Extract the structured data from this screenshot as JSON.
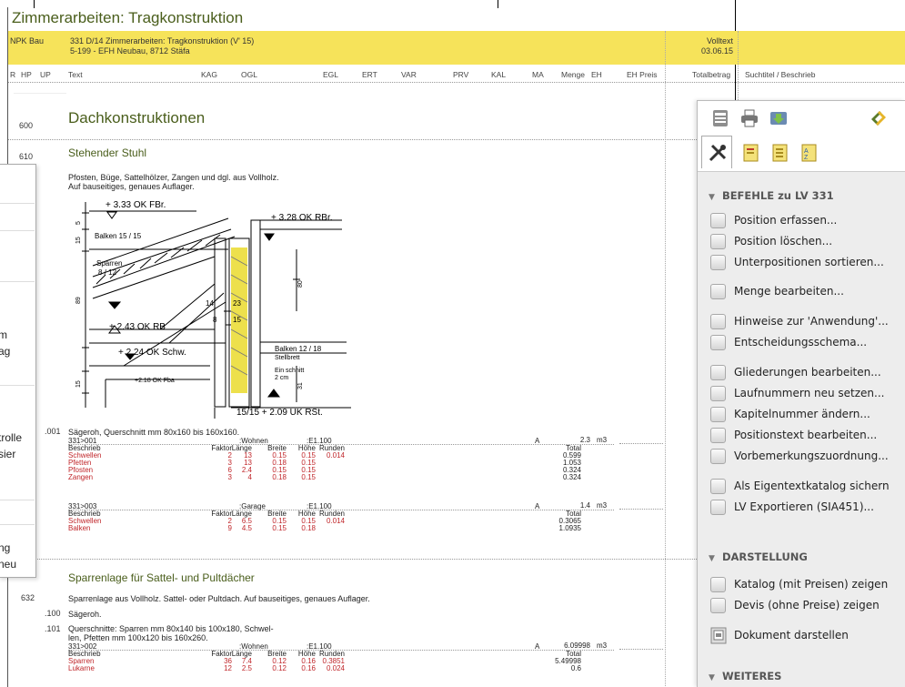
{
  "document": {
    "title": "Zimmerarbeiten: Tragkonstruktion",
    "header": {
      "left": "NPK Bau",
      "line1": "331 D/14 Zimmerarbeiten: Tragkonstruktion (V' 15)",
      "line2": "5-199 - EFH Neubau, 8712 Stäfa",
      "right1": "Volltext",
      "right2": "03.06.15"
    },
    "columns": [
      "R",
      "HP",
      "UP",
      "Text",
      "KAG",
      "OGL",
      "EGL",
      "ERT",
      "VAR",
      "PRV",
      "KAL",
      "MA",
      "Menge",
      "EH",
      "EH Preis",
      "Totalbetrag",
      "Suchtitel / Beschrieb"
    ],
    "sections": {
      "s600_num": "600",
      "s600_title": "Dachkonstruktionen",
      "s610_num": "610",
      "s610_title": "Stehender Stuhl",
      "s610_text1": "Pfosten, Büge, Sattelhölzer, Zangen und dgl. aus Vollholz.",
      "s610_text2": "Auf bauseitiges, genaues Auflager.",
      "s630_title": "Sparrenlage für Sattel- und Pultdächer",
      "s632_num": "632",
      "s632_text": "Sparrenlage aus Vollholz. Sattel- oder Pultdach. Auf bauseitiges, genaues Auflager."
    },
    "drawing_labels": {
      "l1": "+ 3.33  OK FBr.",
      "l2": "+ 3.28  OK RBr.",
      "l3": "Balken 15 / 15",
      "l4": "Sparren",
      "l5": "8 / 12",
      "l6": "+ 2.43  OK RB",
      "l7": "+ 2.24  OK Schw.",
      "l8": "+2.18 OK Fba",
      "l9": "Balken 12 / 18",
      "l10": "Stellbrett",
      "l11": "Ein schnitt",
      "l12": "2 cm",
      "l13": "15/15  + 2.09  UK RSt.",
      "d1": "5",
      "d2": "15",
      "d3": "89",
      "d4": "15",
      "d5": "80",
      "d6": "31",
      "d7": "14",
      "d8": "23",
      "d9": "8",
      "d10": "15"
    },
    "pos001": {
      "num": ".001",
      "text": "Sägeroh, Querschnitt mm 80x160 bis 160x160.",
      "blocks": [
        {
          "ref": "331>001",
          "name": ":Wohnen",
          "code": ":E1.100",
          "a": "A",
          "menge": "2.3",
          "eh": "m3",
          "hdr": [
            "Beschrieb",
            "Faktor",
            "Länge",
            "Breite",
            "Höhe",
            "Runden",
            "Total"
          ],
          "rows": [
            {
              "b": "Schwellen",
              "f": "2",
              "l": "13",
              "br": "0.15",
              "h": "0.15",
              "r": "0.014",
              "t": "0.599"
            },
            {
              "b": "Pfetten",
              "f": "3",
              "l": "13",
              "br": "0.18",
              "h": "0.15",
              "r": "",
              "t": "1.053"
            },
            {
              "b": "Pfosten",
              "f": "6",
              "l": "2.4",
              "br": "0.15",
              "h": "0.15",
              "r": "",
              "t": "0.324"
            },
            {
              "b": "Zangen",
              "f": "3",
              "l": "4",
              "br": "0.18",
              "h": "0.15",
              "r": "",
              "t": "0.324"
            }
          ]
        },
        {
          "ref": "331>003",
          "name": ":Garage",
          "code": ":E1.100",
          "a": "A",
          "menge": "1.4",
          "eh": "m3",
          "hdr": [
            "Beschrieb",
            "Faktor",
            "Länge",
            "Breite",
            "Höhe",
            "Runden",
            "Total"
          ],
          "rows": [
            {
              "b": "Schwellen",
              "f": "2",
              "l": "6.5",
              "br": "0.15",
              "h": "0.15",
              "r": "0.014",
              "t": "0.3065"
            },
            {
              "b": "Balken",
              "f": "9",
              "l": "4.5",
              "br": "0.15",
              "h": "0.18",
              "r": "",
              "t": "1.0935"
            }
          ]
        }
      ]
    },
    "pos100": {
      "num": ".100",
      "text": "Sägeroh."
    },
    "pos101": {
      "num": ".101",
      "text1": "Querschnitte: Sparren mm 80x140 bis 100x180, Schwel-",
      "text2": "len, Pfetten mm 100x120 bis 160x260.",
      "ref": "331>002",
      "name": ":Wohnen",
      "code": ":E1.100",
      "a": "A",
      "menge": "6.09998",
      "eh": "m3",
      "hdr": [
        "Beschrieb",
        "Faktor",
        "Länge",
        "Breite",
        "Höhe",
        "Runden",
        "Total"
      ],
      "rows": [
        {
          "b": "Sparren",
          "f": "36",
          "l": "7.4",
          "br": "0.12",
          "h": "0.16",
          "r": "0.3851",
          "t": "5.49998"
        },
        {
          "b": "Lukarne",
          "f": "12",
          "l": "2.5",
          "br": "0.12",
          "h": "0.16",
          "r": "0.024",
          "t": "0.6"
        }
      ]
    }
  },
  "left_panel": {
    "items": [
      "m",
      "ag",
      "trolle",
      "sier",
      "ng",
      "neu"
    ]
  },
  "right_panel": {
    "toolbar_icons": [
      "document-icon",
      "print-icon",
      "import-icon",
      "sync-icon"
    ],
    "tab_icons": [
      "tools-tab-icon",
      "catalog-tab-icon",
      "document-tab-icon",
      "sort-tab-icon"
    ],
    "befehle_title": "BEFEHLE zu LV 331",
    "befehle": [
      "Position erfassen...",
      "Position löschen...",
      "Unterpositionen sortieren...",
      "Menge bearbeiten...",
      "Hinweise zur 'Anwendung'...",
      "Entscheidungsschema...",
      "Gliederungen bearbeiten...",
      "Laufnummern neu setzen...",
      "Kapitelnummer ändern...",
      "Positionstext bearbeiten...",
      "Vorbemerkungszuordnung...",
      "Als Eigentextkatalog sichern",
      "LV Exportieren (SIA451)..."
    ],
    "darstellung_title": "DARSTELLUNG",
    "darstellung": [
      "Katalog (mit Preisen) zeigen",
      "Devis (ohne Preise) zeigen",
      "Dokument darstellen"
    ],
    "weiteres_title": "WEITERES"
  }
}
